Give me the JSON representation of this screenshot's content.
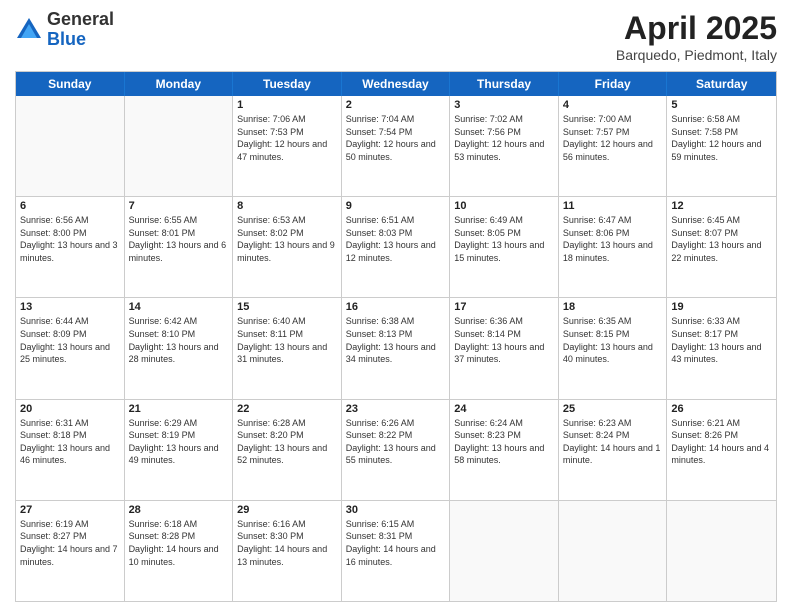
{
  "header": {
    "logo": {
      "general": "General",
      "blue": "Blue"
    },
    "title": "April 2025",
    "location": "Barquedo, Piedmont, Italy"
  },
  "weekdays": [
    "Sunday",
    "Monday",
    "Tuesday",
    "Wednesday",
    "Thursday",
    "Friday",
    "Saturday"
  ],
  "weeks": [
    [
      {
        "day": "",
        "info": ""
      },
      {
        "day": "",
        "info": ""
      },
      {
        "day": "1",
        "info": "Sunrise: 7:06 AM\nSunset: 7:53 PM\nDaylight: 12 hours and 47 minutes."
      },
      {
        "day": "2",
        "info": "Sunrise: 7:04 AM\nSunset: 7:54 PM\nDaylight: 12 hours and 50 minutes."
      },
      {
        "day": "3",
        "info": "Sunrise: 7:02 AM\nSunset: 7:56 PM\nDaylight: 12 hours and 53 minutes."
      },
      {
        "day": "4",
        "info": "Sunrise: 7:00 AM\nSunset: 7:57 PM\nDaylight: 12 hours and 56 minutes."
      },
      {
        "day": "5",
        "info": "Sunrise: 6:58 AM\nSunset: 7:58 PM\nDaylight: 12 hours and 59 minutes."
      }
    ],
    [
      {
        "day": "6",
        "info": "Sunrise: 6:56 AM\nSunset: 8:00 PM\nDaylight: 13 hours and 3 minutes."
      },
      {
        "day": "7",
        "info": "Sunrise: 6:55 AM\nSunset: 8:01 PM\nDaylight: 13 hours and 6 minutes."
      },
      {
        "day": "8",
        "info": "Sunrise: 6:53 AM\nSunset: 8:02 PM\nDaylight: 13 hours and 9 minutes."
      },
      {
        "day": "9",
        "info": "Sunrise: 6:51 AM\nSunset: 8:03 PM\nDaylight: 13 hours and 12 minutes."
      },
      {
        "day": "10",
        "info": "Sunrise: 6:49 AM\nSunset: 8:05 PM\nDaylight: 13 hours and 15 minutes."
      },
      {
        "day": "11",
        "info": "Sunrise: 6:47 AM\nSunset: 8:06 PM\nDaylight: 13 hours and 18 minutes."
      },
      {
        "day": "12",
        "info": "Sunrise: 6:45 AM\nSunset: 8:07 PM\nDaylight: 13 hours and 22 minutes."
      }
    ],
    [
      {
        "day": "13",
        "info": "Sunrise: 6:44 AM\nSunset: 8:09 PM\nDaylight: 13 hours and 25 minutes."
      },
      {
        "day": "14",
        "info": "Sunrise: 6:42 AM\nSunset: 8:10 PM\nDaylight: 13 hours and 28 minutes."
      },
      {
        "day": "15",
        "info": "Sunrise: 6:40 AM\nSunset: 8:11 PM\nDaylight: 13 hours and 31 minutes."
      },
      {
        "day": "16",
        "info": "Sunrise: 6:38 AM\nSunset: 8:13 PM\nDaylight: 13 hours and 34 minutes."
      },
      {
        "day": "17",
        "info": "Sunrise: 6:36 AM\nSunset: 8:14 PM\nDaylight: 13 hours and 37 minutes."
      },
      {
        "day": "18",
        "info": "Sunrise: 6:35 AM\nSunset: 8:15 PM\nDaylight: 13 hours and 40 minutes."
      },
      {
        "day": "19",
        "info": "Sunrise: 6:33 AM\nSunset: 8:17 PM\nDaylight: 13 hours and 43 minutes."
      }
    ],
    [
      {
        "day": "20",
        "info": "Sunrise: 6:31 AM\nSunset: 8:18 PM\nDaylight: 13 hours and 46 minutes."
      },
      {
        "day": "21",
        "info": "Sunrise: 6:29 AM\nSunset: 8:19 PM\nDaylight: 13 hours and 49 minutes."
      },
      {
        "day": "22",
        "info": "Sunrise: 6:28 AM\nSunset: 8:20 PM\nDaylight: 13 hours and 52 minutes."
      },
      {
        "day": "23",
        "info": "Sunrise: 6:26 AM\nSunset: 8:22 PM\nDaylight: 13 hours and 55 minutes."
      },
      {
        "day": "24",
        "info": "Sunrise: 6:24 AM\nSunset: 8:23 PM\nDaylight: 13 hours and 58 minutes."
      },
      {
        "day": "25",
        "info": "Sunrise: 6:23 AM\nSunset: 8:24 PM\nDaylight: 14 hours and 1 minute."
      },
      {
        "day": "26",
        "info": "Sunrise: 6:21 AM\nSunset: 8:26 PM\nDaylight: 14 hours and 4 minutes."
      }
    ],
    [
      {
        "day": "27",
        "info": "Sunrise: 6:19 AM\nSunset: 8:27 PM\nDaylight: 14 hours and 7 minutes."
      },
      {
        "day": "28",
        "info": "Sunrise: 6:18 AM\nSunset: 8:28 PM\nDaylight: 14 hours and 10 minutes."
      },
      {
        "day": "29",
        "info": "Sunrise: 6:16 AM\nSunset: 8:30 PM\nDaylight: 14 hours and 13 minutes."
      },
      {
        "day": "30",
        "info": "Sunrise: 6:15 AM\nSunset: 8:31 PM\nDaylight: 14 hours and 16 minutes."
      },
      {
        "day": "",
        "info": ""
      },
      {
        "day": "",
        "info": ""
      },
      {
        "day": "",
        "info": ""
      }
    ]
  ]
}
